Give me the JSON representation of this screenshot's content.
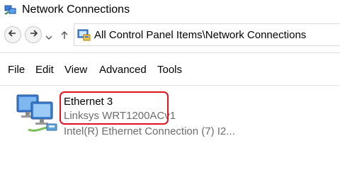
{
  "window": {
    "title": "Network Connections",
    "title_icon": "network-connections-icon"
  },
  "navigation": {
    "back_icon": "back-arrow-icon",
    "forward_icon": "forward-arrow-icon",
    "recent_icon": "chevron-down-icon",
    "up_icon": "up-arrow-icon"
  },
  "address": {
    "icon": "control-panel-icon",
    "path": "All Control Panel Items\\Network Connections"
  },
  "menu": {
    "items": [
      "File",
      "Edit",
      "View",
      "Advanced",
      "Tools"
    ]
  },
  "connection": {
    "icon": "ethernet-connection-icon",
    "name": "Ethernet 3",
    "device": "Linksys WRT1200ACv1",
    "adapter": "Intel(R) Ethernet Connection (7) I2..."
  },
  "colors": {
    "highlight_border": "#e0141e",
    "secondary_text": "#6d6d6d"
  }
}
